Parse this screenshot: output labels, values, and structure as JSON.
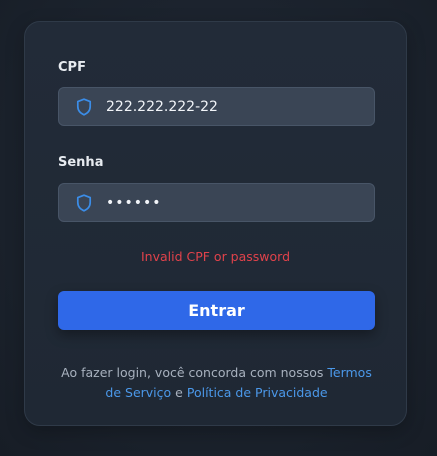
{
  "form": {
    "cpf_label": "CPF",
    "cpf_value": "222.222.222-22",
    "senha_label": "Senha",
    "senha_value": "••••••",
    "error_message": "Invalid CPF or password",
    "submit_label": "Entrar"
  },
  "terms": {
    "prefix": "Ao fazer login, você concorda com nossos",
    "terms_link": "Termos de Serviço",
    "conjunction": "e",
    "privacy_link": "Política de Privacidade"
  },
  "icons": {
    "cpf_field_icon": "shield-icon",
    "senha_field_icon": "shield-icon"
  },
  "colors": {
    "accent": "#2f68e8",
    "link": "#4b98e9",
    "error": "#e0424b",
    "icon": "#3b8de8"
  }
}
